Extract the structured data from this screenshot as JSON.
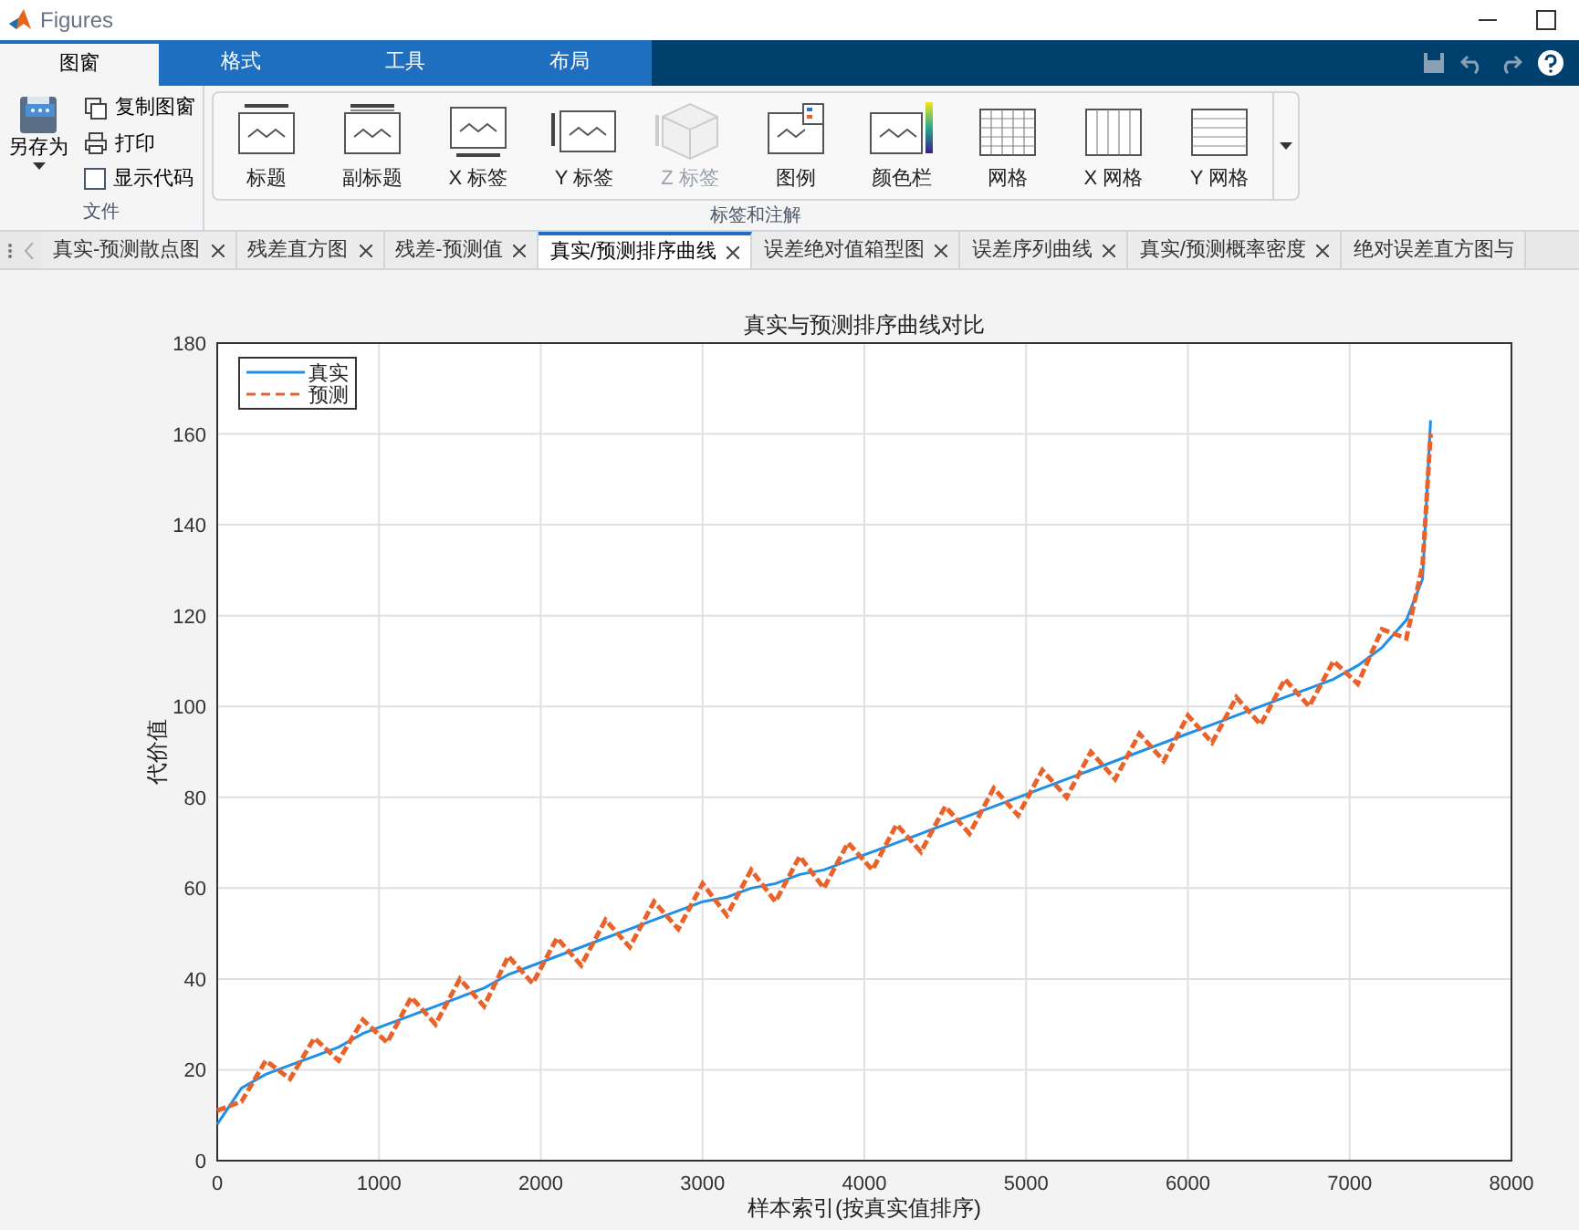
{
  "window": {
    "title": "Figures"
  },
  "ribbon_tabs": [
    {
      "label": "图窗",
      "selected": true
    },
    {
      "label": "格式",
      "selected": false
    },
    {
      "label": "工具",
      "selected": false
    },
    {
      "label": "布局",
      "selected": false
    }
  ],
  "file_section": {
    "save_as": "另存为",
    "copy": "复制图窗",
    "print": "打印",
    "show_code": {
      "label": "显示代码",
      "checked": false
    },
    "label": "文件"
  },
  "labels_section": {
    "label": "标签和注解",
    "items": [
      {
        "kind": "title",
        "label": "标题",
        "disabled": false
      },
      {
        "kind": "subtitle",
        "label": "副标题",
        "disabled": false
      },
      {
        "kind": "xlabel",
        "label": "X 标签",
        "disabled": false
      },
      {
        "kind": "ylabel",
        "label": "Y 标签",
        "disabled": false
      },
      {
        "kind": "zlabel",
        "label": "Z 标签",
        "disabled": true
      },
      {
        "kind": "legend",
        "label": "图例",
        "disabled": false
      },
      {
        "kind": "colorbar",
        "label": "颜色栏",
        "disabled": false
      },
      {
        "kind": "grid",
        "label": "网格",
        "disabled": false
      },
      {
        "kind": "xgrid",
        "label": "X 网格",
        "disabled": false
      },
      {
        "kind": "ygrid",
        "label": "Y 网格",
        "disabled": false
      }
    ]
  },
  "figure_tabs": [
    {
      "label": "真实-预测散点图",
      "selected": false
    },
    {
      "label": "残差直方图",
      "selected": false
    },
    {
      "label": "残差-预测值",
      "selected": false
    },
    {
      "label": "真实/预测排序曲线",
      "selected": true
    },
    {
      "label": "误差绝对值箱型图",
      "selected": false
    },
    {
      "label": "误差序列曲线",
      "selected": false
    },
    {
      "label": "真实/预测概率密度",
      "selected": false
    },
    {
      "label": "绝对误差直方图与",
      "selected": false
    }
  ],
  "chart_data": {
    "type": "line",
    "title": "真实与预测排序曲线对比",
    "xlabel": "样本索引(按真实值排序)",
    "ylabel": "代价值",
    "x": [
      0,
      150,
      300,
      450,
      600,
      750,
      900,
      1050,
      1200,
      1350,
      1500,
      1650,
      1800,
      1950,
      2100,
      2250,
      2400,
      2550,
      2700,
      2850,
      3000,
      3150,
      3300,
      3450,
      3600,
      3750,
      3900,
      4050,
      4200,
      4350,
      4500,
      4650,
      4800,
      4950,
      5100,
      5250,
      5400,
      5550,
      5700,
      5850,
      6000,
      6150,
      6300,
      6450,
      6600,
      6750,
      6900,
      7050,
      7200,
      7350,
      7450,
      7500
    ],
    "series": [
      {
        "name": "真实",
        "color": "#1f8fe8",
        "line_style": "solid",
        "values": [
          8,
          16,
          19,
          21,
          23,
          25,
          28,
          30,
          32,
          34,
          36,
          38,
          41,
          43,
          45,
          47,
          49,
          51,
          53,
          55,
          57,
          58,
          60,
          61,
          63,
          64,
          66,
          68,
          70,
          72,
          74,
          76,
          78,
          80,
          82,
          84,
          86,
          88,
          90,
          92,
          94,
          96,
          98,
          100,
          102,
          104,
          106,
          109,
          113,
          119,
          128,
          163
        ]
      },
      {
        "name": "预测",
        "color": "#e8622a",
        "line_style": "dashed",
        "values": [
          11,
          13,
          22,
          18,
          27,
          22,
          31,
          26,
          36,
          30,
          40,
          34,
          45,
          39,
          49,
          43,
          53,
          47,
          57,
          51,
          61,
          54,
          64,
          57,
          67,
          60,
          70,
          64,
          74,
          68,
          78,
          72,
          82,
          76,
          86,
          80,
          90,
          84,
          94,
          88,
          98,
          92,
          102,
          96,
          106,
          100,
          110,
          105,
          117,
          115,
          131,
          160
        ]
      }
    ],
    "grid": true,
    "legend": true,
    "xlim": [
      0,
      8000
    ],
    "ylim": [
      0,
      180
    ],
    "xticks": [
      0,
      1000,
      2000,
      3000,
      4000,
      5000,
      6000,
      7000,
      8000
    ],
    "yticks": [
      0,
      20,
      40,
      60,
      80,
      100,
      120,
      140,
      160,
      180
    ]
  }
}
